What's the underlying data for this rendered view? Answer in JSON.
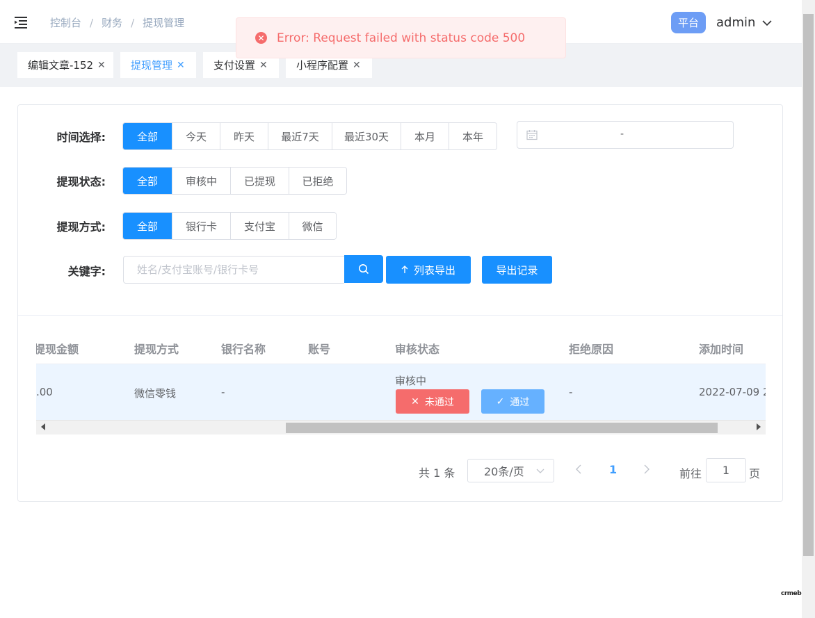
{
  "header": {
    "breadcrumb": [
      "控制台",
      "财务",
      "提现管理"
    ],
    "platform_badge": "平台",
    "user": "admin"
  },
  "toast": {
    "message": "Error: Request failed with status code 500",
    "color": "#f56c6c"
  },
  "tabs": [
    {
      "label": "编辑文章-152",
      "active": false
    },
    {
      "label": "提现管理",
      "active": true
    },
    {
      "label": "支付设置",
      "active": false
    },
    {
      "label": "小程序配置",
      "active": false
    }
  ],
  "filters": {
    "time": {
      "label": "时间选择:",
      "options": [
        "全部",
        "今天",
        "昨天",
        "最近7天",
        "最近30天",
        "本月",
        "本年"
      ],
      "selected": "全部"
    },
    "date_range": {
      "separator": "-"
    },
    "status": {
      "label": "提现状态:",
      "options": [
        "全部",
        "审核中",
        "已提现",
        "已拒绝"
      ],
      "selected": "全部"
    },
    "method": {
      "label": "提现方式:",
      "options": [
        "全部",
        "银行卡",
        "支付宝",
        "微信"
      ],
      "selected": "全部"
    },
    "keyword": {
      "label": "关键字:",
      "placeholder": "姓名/支付宝账号/银行卡号",
      "value": ""
    },
    "export_label": "列表导出",
    "export_records_label": "导出记录"
  },
  "table": {
    "columns": [
      "提现金额",
      "提现方式",
      "银行名称",
      "账号",
      "审核状态",
      "拒绝原因",
      "添加时间"
    ],
    "rows": [
      {
        "amount": ".00",
        "method": "微信零钱",
        "bank": "-",
        "account": "",
        "status": "审核中",
        "reject_label": "未通过",
        "pass_label": "通过",
        "reason": "-",
        "time": "2022-07-09 2"
      }
    ]
  },
  "pagination": {
    "total": "共 1 条",
    "page_size": "20条/页",
    "current": "1",
    "goto_label": "前往",
    "goto_value": "1",
    "goto_suffix": "页"
  },
  "watermark": "crmeb",
  "colors": {
    "primary": "#1890ff",
    "danger": "#f56c6c",
    "pass": "#66b1ff",
    "badge": "#6d9df5"
  }
}
